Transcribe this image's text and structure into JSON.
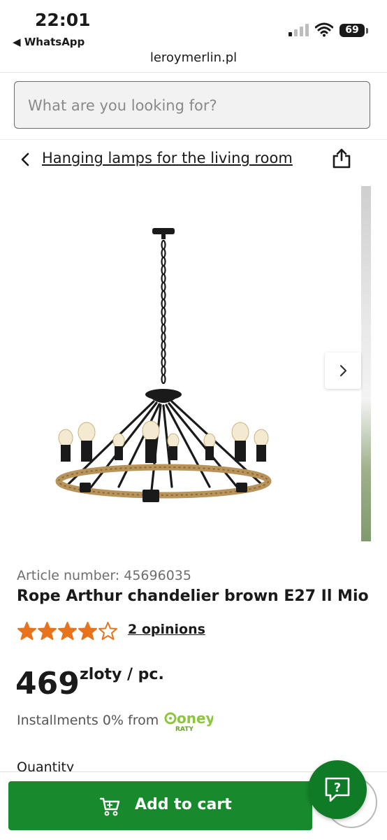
{
  "status_bar": {
    "time": "22:01",
    "back_app": "◀ WhatsApp",
    "battery": "69"
  },
  "browser": {
    "url": "leroymerlin.pl"
  },
  "search": {
    "placeholder": "What are you looking for?"
  },
  "breadcrumb": {
    "back_icon": "chevron-left-icon",
    "label": "Hanging lamps for the living room",
    "share_icon": "share-icon"
  },
  "gallery": {
    "image": "chandelier-image",
    "next_icon": "chevron-right-icon"
  },
  "product": {
    "article_number": "Article number: 45696035",
    "title": "Rope Arthur chandelier brown E27 Il Mio",
    "rating": 4,
    "rating_max": 5,
    "opinions": "2 opinions",
    "price": "469",
    "price_unit": "zloty / pc.",
    "installments": "Installments 0% from",
    "installments_brand": "oney",
    "installments_sub": "RATY",
    "quantity_label": "Quantity"
  },
  "actions": {
    "add_to_cart": "Add to cart",
    "help_icon": "chat-question-icon"
  },
  "colors": {
    "brand_green": "#188a2d",
    "help_green": "#0f7b26",
    "star_orange": "#e8731a",
    "oney_green": "#8cc63f"
  }
}
